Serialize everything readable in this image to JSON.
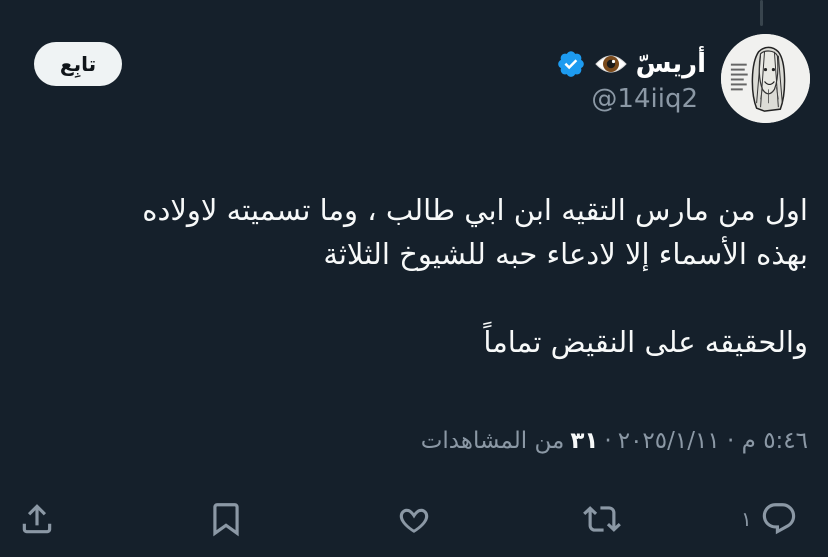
{
  "tweet": {
    "display_name": "أريسّ",
    "handle": "@14iiq2",
    "follow_label": "تابِع",
    "lines": [
      "اول من مارس التقيه ابن ابي طالب ، وما تسميته لاولاده",
      "بهذه الأسماء إلا لادعاء حبه للشيوخ الثلاثة",
      "",
      "والحقيقه على النقيض تماماً"
    ],
    "timestamp": "٥:٤٦ م · ٢٠٢٥/١/١١",
    "separator": "·",
    "views_count": "٣١",
    "views_label": "من المشاهدات"
  },
  "actions": {
    "reply_count": "١",
    "icons": [
      "reply-icon",
      "retweet-icon",
      "like-icon",
      "bookmark-icon",
      "share-icon"
    ]
  },
  "colors": {
    "background": "#15202b",
    "text": "#f7f9f9",
    "muted": "#8b98a5",
    "verified": "#1d9bf0",
    "follow_bg": "#eff3f4"
  }
}
